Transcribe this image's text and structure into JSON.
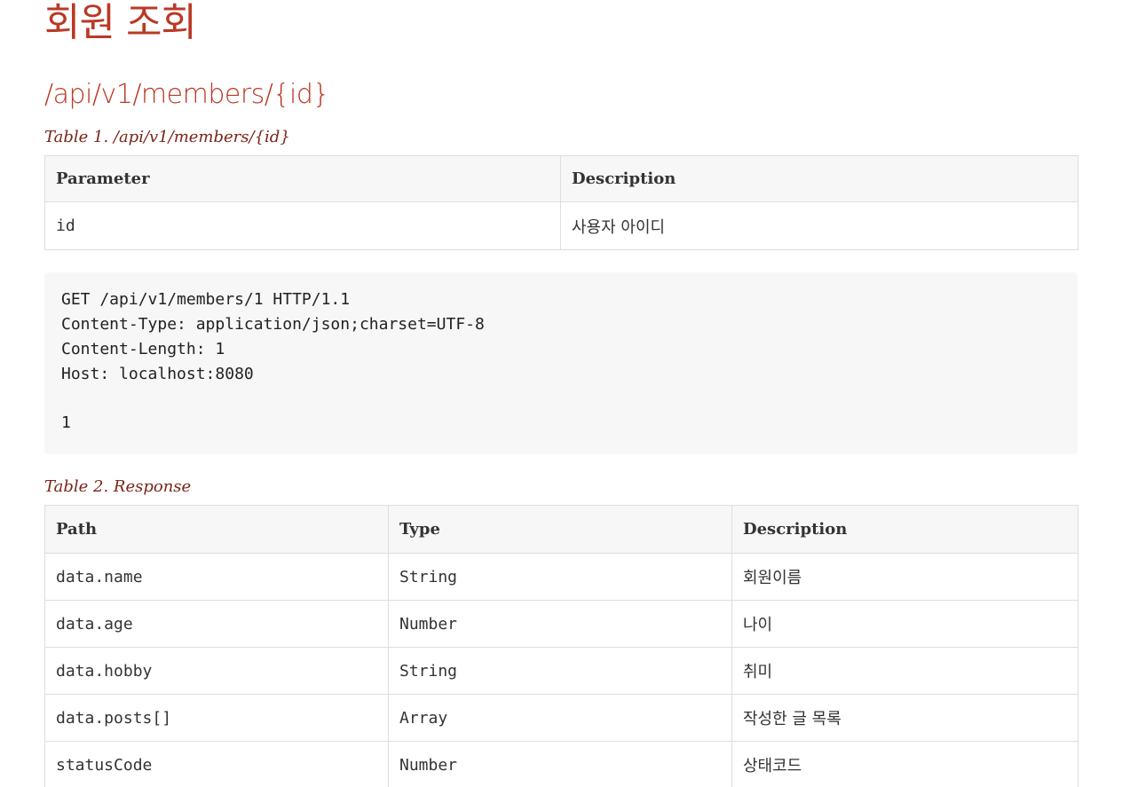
{
  "page": {
    "title": "회원 조회"
  },
  "section": {
    "endpoint": "/api/v1/members/{id}"
  },
  "request_params_table": {
    "caption": "Table 1. /api/v1/members/{id}",
    "headers": [
      "Parameter",
      "Description"
    ],
    "rows": [
      {
        "parameter": "id",
        "description": "사용자 아이디"
      }
    ]
  },
  "http_request": {
    "lines": [
      "GET /api/v1/members/1 HTTP/1.1",
      "Content-Type: application/json;charset=UTF-8",
      "Content-Length: 1",
      "Host: localhost:8080",
      "",
      "1"
    ]
  },
  "response_table": {
    "caption": "Table 2. Response",
    "headers": [
      "Path",
      "Type",
      "Description"
    ],
    "rows": [
      {
        "path": "data.name",
        "type": "String",
        "description": "회원이름"
      },
      {
        "path": "data.age",
        "type": "Number",
        "description": "나이"
      },
      {
        "path": "data.hobby",
        "type": "String",
        "description": "취미"
      },
      {
        "path": "data.posts[]",
        "type": "Array",
        "description": "작성한 글 목록"
      },
      {
        "path": "statusCode",
        "type": "Number",
        "description": "상태코드"
      }
    ]
  },
  "colors": {
    "heading": "#ba3925",
    "caption": "#7a2518",
    "table_header_bg": "#f7f7f8",
    "table_border": "#dedede",
    "code_bg": "#f7f7f7"
  }
}
